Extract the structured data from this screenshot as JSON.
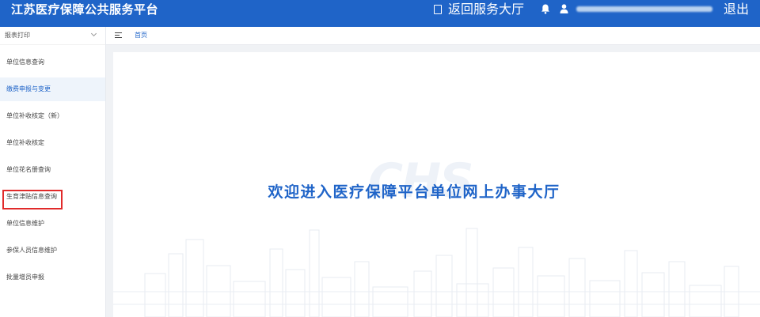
{
  "header": {
    "app_title": "江苏医疗保障公共服务平台",
    "return_label": "返回服务大厅",
    "logout_label": "退出"
  },
  "sidebar": {
    "group_label": "报表打印",
    "items": [
      {
        "label": "单位信息查询"
      },
      {
        "label": "缴费申报与变更",
        "active": true
      },
      {
        "label": "单位补收核定（新）"
      },
      {
        "label": "单位补收核定"
      },
      {
        "label": "单位花名册查询"
      },
      {
        "label": "生育津贴信息查询",
        "highlighted": true
      },
      {
        "label": "单位信息维护"
      },
      {
        "label": "参保人员信息维护"
      },
      {
        "label": "批量增员申报"
      }
    ]
  },
  "tabs": {
    "home_label": "首页"
  },
  "main": {
    "welcome_text": "欢迎进入医疗保障平台单位网上办事大厅",
    "watermark_text": "CHS"
  },
  "colors": {
    "brand": "#1f64c8",
    "highlight": "#e12a2a",
    "active_bg": "#eef4fb"
  },
  "icons": [
    "return-icon",
    "bell-icon",
    "user-icon",
    "chevron-down-icon",
    "menu-toggle-icon"
  ]
}
